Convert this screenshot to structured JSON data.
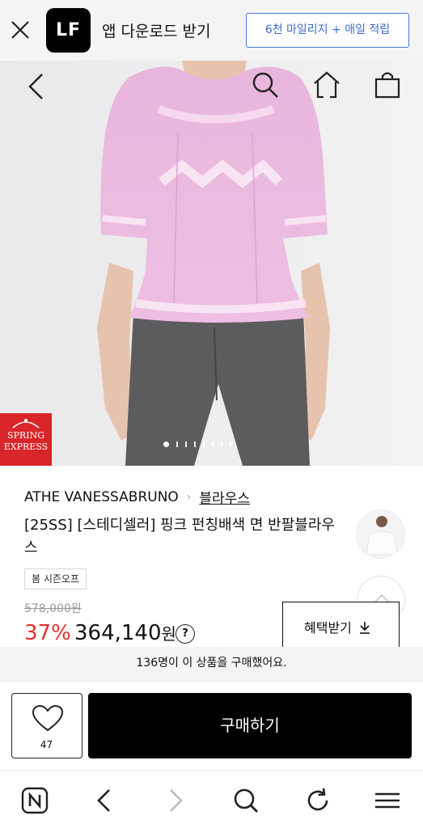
{
  "app_banner": {
    "logo_text": "LF",
    "download_text": "앱 다운로드 받기",
    "mileage_button": "6천 마일리지 + 매일 적립"
  },
  "hero": {
    "badge_line1": "SPRING",
    "badge_line2": "EXPRESS",
    "slide_count": 8,
    "active_slide": 1
  },
  "product": {
    "brand": "ATHE VANESSABRUNO",
    "category": "블라우스",
    "title": "[25SS] [스테디셀러] 핑크 펀칭배색 면 반팔블라우스",
    "tag": "봄 시즌오프",
    "original_price": "578,000원",
    "discount": "37%",
    "price": "364,140",
    "price_unit": "원",
    "price_info": "?",
    "benefit_button": "혜택받기"
  },
  "purchased_text": "136명이 이 상품을 구매했어요.",
  "buy_bar": {
    "like_count": "47",
    "purchase_button": "구매하기"
  },
  "colors": {
    "discount_red": "#e0312c",
    "mileage_blue": "#3c6ad1",
    "badge_red": "#d9262a"
  }
}
